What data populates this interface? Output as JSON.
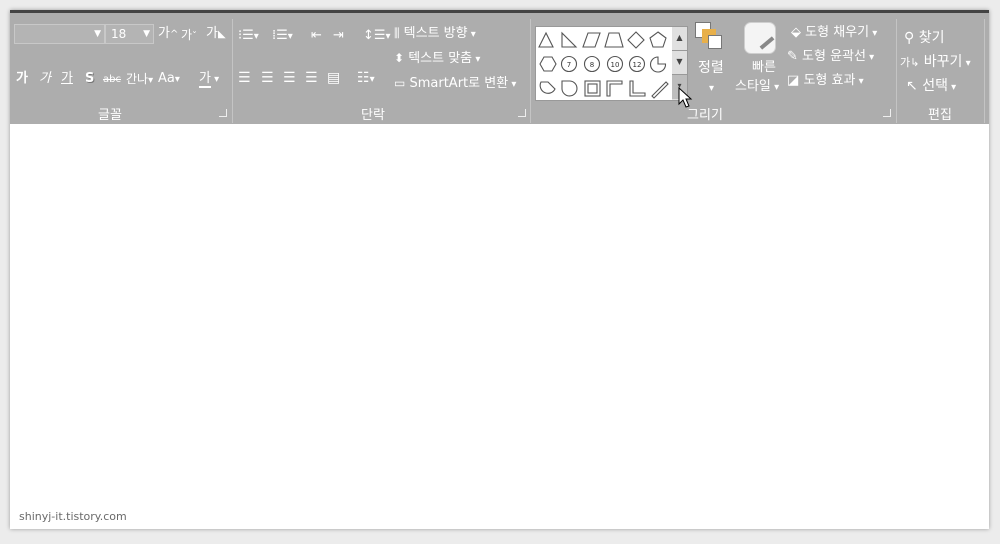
{
  "font_group": {
    "label": "글꼴",
    "font_name": "",
    "font_size": "18",
    "increase_size": "가",
    "decrease_size": "가",
    "clear_format": "가",
    "bold": "가",
    "italic": "가",
    "underline": "가",
    "shadow": "S",
    "strikethrough": "abc",
    "char_spacing": "간나",
    "change_case": "Aa",
    "font_color": "가"
  },
  "paragraph_group": {
    "label": "단락",
    "text_direction": "텍스트 방향",
    "align_text": "텍스트 맞춤",
    "smartart": "SmartArt로 변환"
  },
  "drawing_group": {
    "label": "그리기",
    "arrange": "정렬",
    "quick_styles_line1": "빠른",
    "quick_styles_line2": "스타일",
    "shape_fill": "도형 채우기",
    "shape_outline": "도형 윤곽선",
    "shape_effects": "도형 효과",
    "numbered_shapes": [
      "7",
      "8",
      "10",
      "12"
    ]
  },
  "editing_group": {
    "label": "편집",
    "find": "찾기",
    "replace": "바꾸기",
    "select": "선택"
  },
  "watermark": "shinyj-it.tistory.com",
  "colors": {
    "ribbon_bg": "#adadad",
    "ribbon_text": "#ffffff",
    "arrange_accent": "#e8b04a"
  }
}
